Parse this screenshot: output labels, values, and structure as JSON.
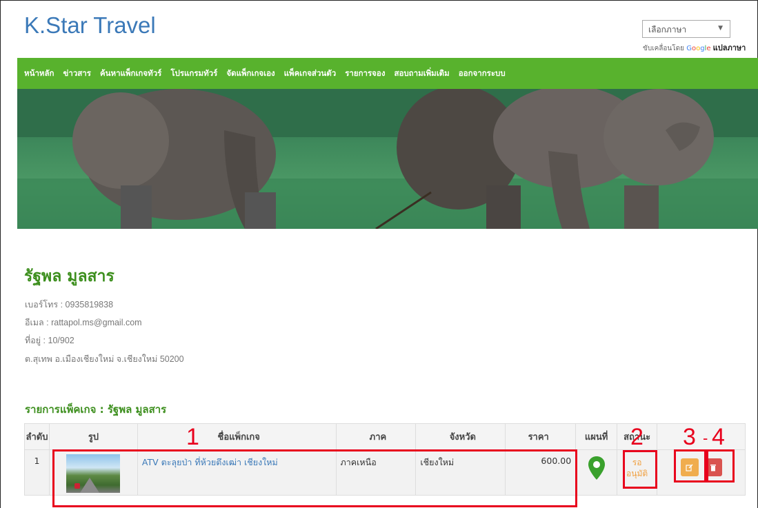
{
  "brand": "K.Star Travel",
  "translate": {
    "select_label": "เลือกภาษา",
    "caret": "▼",
    "powered_prefix": "ขับเคลื่อนโดย",
    "google": [
      "G",
      "o",
      "o",
      "g",
      "l",
      "e"
    ],
    "translate_word": "แปลภาษา"
  },
  "nav": [
    "หน้าหลัก",
    "ข่าวสาร",
    "ค้นหาแพ็กเกจทัวร์",
    "โปรแกรมทัวร์",
    "จัดแพ็กเกจเอง",
    "แพ็คเกจส่วนตัว",
    "รายการจอง",
    "สอบถามเพิ่มเติม",
    "ออกจากระบบ"
  ],
  "profile": {
    "name": "รัฐพล มูลสาร",
    "phone": "เบอร์โทร : 0935819838",
    "email": "อีเมล : rattapol.ms@gmail.com",
    "address": "ที่อยู่ : 10/902",
    "address2": "ต.สุเทพ อ.เมืองเชียงใหม่ จ.เชียงใหม่ 50200"
  },
  "packages": {
    "title": "รายการแพ็คเกจ : รัฐพล มูลสาร",
    "headers": {
      "no": "ลำดับ",
      "image": "รูป",
      "name": "ชื่อแพ็กเกจ",
      "region": "ภาค",
      "province": "จังหวัด",
      "price": "ราคา",
      "map": "แผนที่",
      "status": "สถานะ"
    },
    "rows": [
      {
        "no": "1",
        "name": "ATV ตะลุยป่า ที่ห้วยตึงเฒ่า เชียงใหม่",
        "region": "ภาคเหนือ",
        "province": "เชียงใหม่",
        "price": "600.00",
        "status_line1": "รอ",
        "status_line2": "อนุมัติ"
      }
    ]
  },
  "annotations": {
    "n1": "1",
    "n2": "2",
    "n3": "3",
    "dash": "-",
    "n4": "4"
  },
  "colors": {
    "brand": "#3b79b8",
    "nav_bg": "#58b22d",
    "accent_green": "#3d8f1e",
    "annotation_red": "#e8001c",
    "edit_button": "#f0ad4e",
    "delete_button": "#d9534f",
    "status_text": "#f0a040"
  },
  "icons": [
    "map-pin-icon",
    "edit-icon",
    "trash-icon"
  ]
}
